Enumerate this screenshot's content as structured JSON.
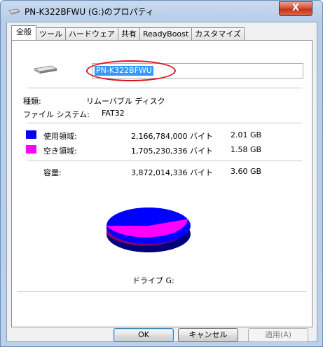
{
  "window": {
    "title": "PN-K322BFWU (G:)のプロパティ",
    "close_glyph": "X"
  },
  "tabs": [
    {
      "label": "全般"
    },
    {
      "label": "ツール"
    },
    {
      "label": "ハードウェア"
    },
    {
      "label": "共有"
    },
    {
      "label": "ReadyBoost"
    },
    {
      "label": "カスタマイズ"
    }
  ],
  "general": {
    "drive_name": "PN-K322BFWU",
    "type_label": "種類:",
    "type_value": "リムーバブル ディスク",
    "fs_label": "ファイル システム:",
    "fs_value": "FAT32",
    "used_label": "使用領域:",
    "used_bytes": "2,166,784,000 バイト",
    "used_gb": "2.01 GB",
    "free_label": "空き領域:",
    "free_bytes": "1,705,230,336 バイト",
    "free_gb": "1.58 GB",
    "capacity_label": "容量:",
    "capacity_bytes": "3,872,014,336 バイト",
    "capacity_gb": "3.60 GB",
    "drive_caption": "ドライブ G:",
    "used_fraction": 0.5596
  },
  "colors": {
    "used": "#0000ff",
    "free": "#ff00ff",
    "highlight": "#e0101a"
  },
  "buttons": {
    "ok": "OK",
    "cancel": "キャンセル",
    "apply": "適用(A)"
  }
}
